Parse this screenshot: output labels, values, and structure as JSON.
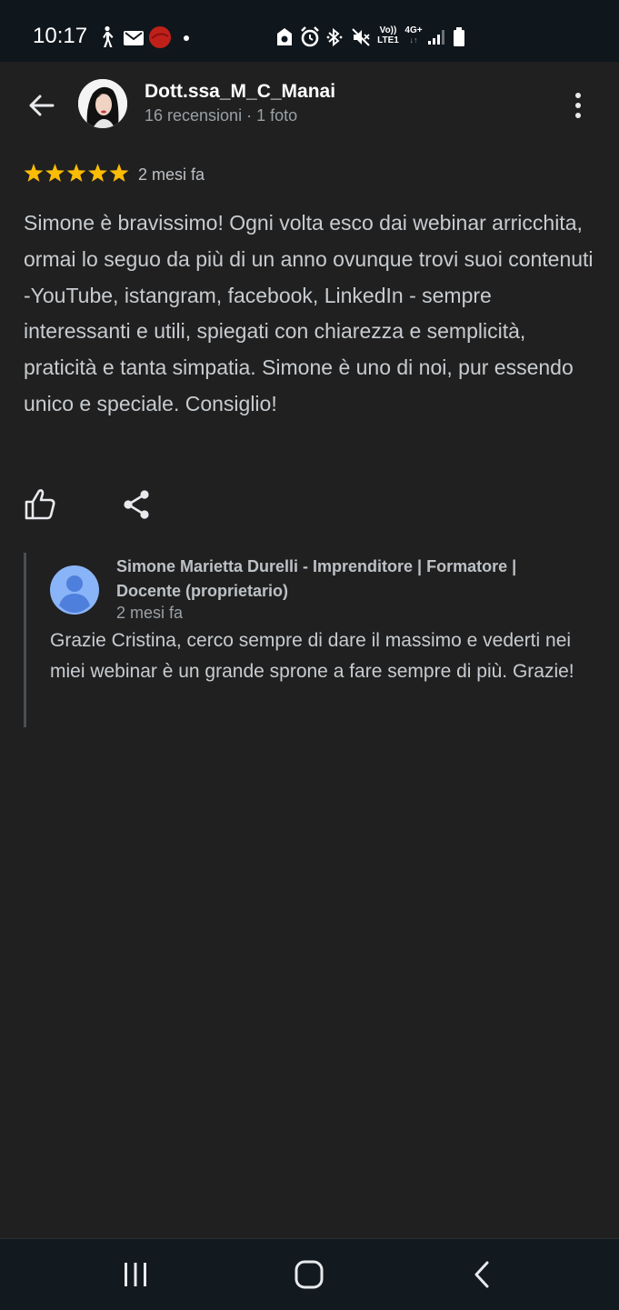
{
  "status_bar": {
    "time": "10:17",
    "network_label_top": "Vo))",
    "network_label_bottom": "LTE1",
    "data_type": "4G+"
  },
  "header": {
    "reviewer_name": "Dott.ssa_M_C_Manai",
    "reviewer_meta": "16 recensioni · 1 foto"
  },
  "review": {
    "rating": 5,
    "max_rating": 5,
    "time_ago": "2 mesi fa",
    "text": "Simone è bravissimo! Ogni volta esco dai webinar arricchita, ormai lo seguo da più di un anno ovunque trovi suoi contenuti -YouTube, istangram, facebook, LinkedIn - sempre interessanti e utili, spiegati con chiarezza e semplicità, praticità e tanta simpatia. Simone è uno di noi, pur essendo unico e speciale. Consiglio!"
  },
  "owner_reply": {
    "name": "Simone Marietta Durelli - Imprenditore | Formatore | Docente (proprietario)",
    "time_ago": "2 mesi fa",
    "text": "Grazie Cristina, cerco sempre di dare il massimo e vederti nei miei webinar è un grande sprone a fare sempre di più. Grazie!"
  },
  "icons": {
    "back": "arrow-left-icon",
    "more": "more-vert-icon",
    "like": "thumb-up-icon",
    "share": "share-icon",
    "nav_recents": "recents-icon",
    "nav_home": "home-icon",
    "nav_back": "chevron-left-icon"
  },
  "colors": {
    "background": "#202020",
    "star": "#fbbc04",
    "owner_avatar": "#8ab4f8",
    "status_bar": "#0f161c"
  }
}
